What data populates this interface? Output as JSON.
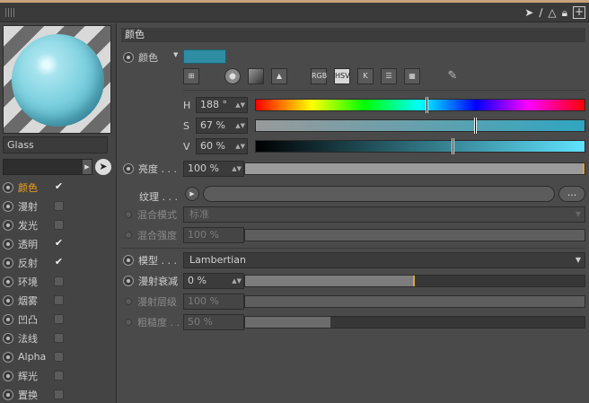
{
  "window": {
    "title_icons": [
      "cursor-arrow-icon",
      "path-icon",
      "triangle-icon",
      "lock-icon",
      "add-icon"
    ]
  },
  "material": {
    "name": "Glass"
  },
  "channels": [
    {
      "label": "颜色",
      "checked": true,
      "active": true
    },
    {
      "label": "漫射",
      "checked": false
    },
    {
      "label": "发光",
      "checked": false
    },
    {
      "label": "透明",
      "checked": true
    },
    {
      "label": "反射",
      "checked": true
    },
    {
      "label": "环境",
      "checked": false
    },
    {
      "label": "烟雾",
      "checked": false
    },
    {
      "label": "凹凸",
      "checked": false
    },
    {
      "label": "法线",
      "checked": false
    },
    {
      "label": "Alpha",
      "checked": false
    },
    {
      "label": "辉光",
      "checked": false
    },
    {
      "label": "置换",
      "checked": false
    }
  ],
  "color_section": {
    "header": "颜色",
    "color_label": "颜色",
    "swatch_color": "#2f8da3",
    "modes": [
      "RGB",
      "HSV",
      "K"
    ],
    "h_label": "H",
    "h_value": "188 °",
    "h_fraction": 0.522,
    "s_label": "S",
    "s_value": "67 %",
    "s_fraction": 0.67,
    "v_label": "V",
    "v_value": "60 %",
    "v_fraction": 0.6,
    "brightness_label": "亮度 . . .",
    "brightness_value": "100 %",
    "brightness_fraction": 1.0,
    "texture_label": "纹理 . . .",
    "texture_more": "...",
    "blend_mode_label": "混合模式",
    "blend_mode_value": "标准",
    "blend_strength_label": "混合强度",
    "blend_strength_value": "100 %"
  },
  "model_section": {
    "model_label": "模型 . . .",
    "model_value": "Lambertian",
    "diffuse_falloff_label": "漫射衰减",
    "diffuse_falloff_value": "0 %",
    "diffuse_falloff_fraction": 0.5,
    "diffuse_level_label": "漫射层级",
    "diffuse_level_value": "100 %",
    "roughness_label": "粗糙度 . .",
    "roughness_value": "50 %",
    "roughness_fraction": 0.25
  }
}
